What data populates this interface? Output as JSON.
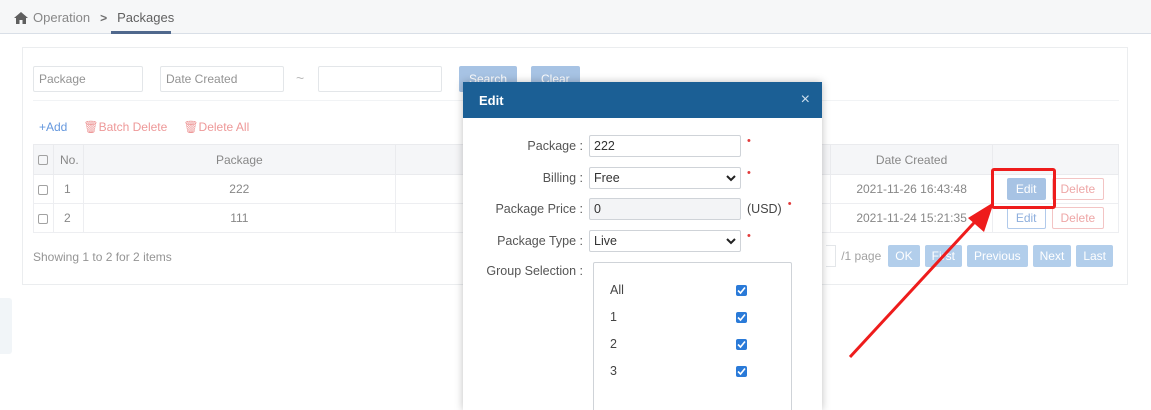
{
  "breadcrumb": {
    "parent": "Operation",
    "separator": ">",
    "current": "Packages"
  },
  "filters": {
    "package_placeholder": "Package",
    "date_placeholder": "Date Created",
    "range_sep": "~",
    "search_label": "Search",
    "clear_label": "Clear"
  },
  "actions": {
    "add": "+Add",
    "batch_delete": "Batch Delete",
    "delete_all": "Delete All"
  },
  "table": {
    "columns": [
      "No.",
      "Package",
      "Date Created"
    ],
    "rows": [
      {
        "no": "1",
        "package": "222",
        "date": "2021-11-26 16:43:48"
      },
      {
        "no": "2",
        "package": "111",
        "date": "2021-11-24 15:21:35"
      }
    ],
    "edit_label": "Edit",
    "delete_label": "Delete"
  },
  "footer": {
    "showing": "Showing 1 to 2 for 2 items",
    "page_suffix": "/1 page",
    "ok": "OK",
    "first": "First",
    "previous": "Previous",
    "next": "Next",
    "last": "Last"
  },
  "modal": {
    "title": "Edit",
    "close": "×",
    "package_label": "Package :",
    "package_value": "222",
    "billing_label": "Billing :",
    "billing_value": "Free",
    "price_label": "Package Price :",
    "price_value": "0",
    "price_unit": "(USD)",
    "type_label": "Package Type :",
    "type_value": "Live",
    "group_label": "Group Selection :",
    "required_mark": "•",
    "groups": [
      {
        "label": "All",
        "checked": true
      },
      {
        "label": "1",
        "checked": true
      },
      {
        "label": "2",
        "checked": true
      },
      {
        "label": "3",
        "checked": true
      }
    ]
  },
  "colors": {
    "modal_header": "#1b5f95",
    "accent": "#8fb3dd",
    "highlight": "#ee1c1c",
    "checkbox": "#2a7ad8"
  }
}
